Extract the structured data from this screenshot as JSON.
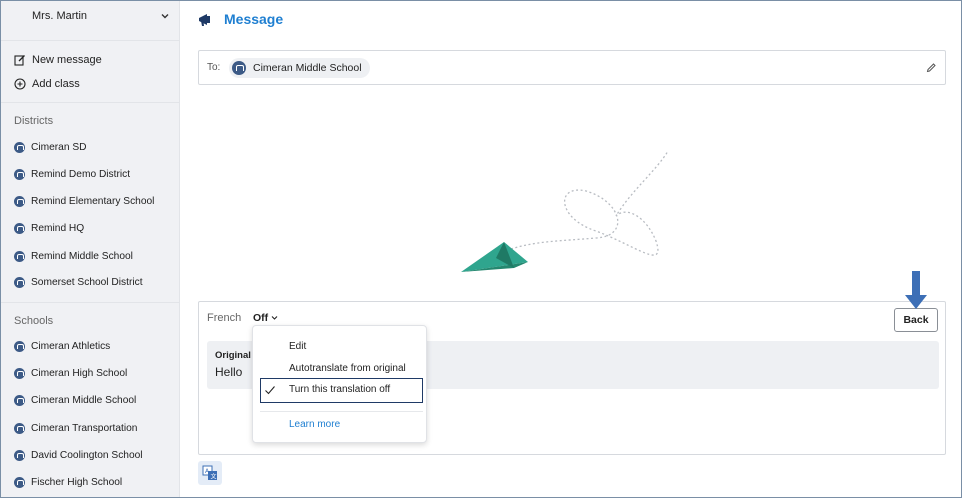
{
  "sidebar": {
    "user_name": "Mrs. Martin",
    "actions": [
      {
        "label": "New message",
        "icon": "compose-icon"
      },
      {
        "label": "Add class",
        "icon": "plus-circle-icon"
      }
    ],
    "districts_label": "Districts",
    "districts": [
      "Cimeran SD",
      "Remind Demo District",
      "Remind Elementary School",
      "Remind HQ",
      "Remind Middle School",
      "Somerset School District"
    ],
    "schools_label": "Schools",
    "schools": [
      "Cimeran Athletics",
      "Cimeran High School",
      "Cimeran Middle School",
      "Cimeran Transportation",
      "David Coolington School",
      "Fischer High School"
    ]
  },
  "header": {
    "title": "Message",
    "icon": "megaphone-icon"
  },
  "recipient": {
    "to_label": "To:",
    "chip_label": "Cimeran Middle School"
  },
  "composer": {
    "language_label": "French",
    "translation_state": "Off",
    "original_label": "Original",
    "original_text": "Hello",
    "back_label": "Back"
  },
  "dropdown": {
    "items": [
      "Edit",
      "Autotranslate from original",
      "Turn this translation off"
    ],
    "selected_index": 2,
    "learn_more": "Learn more"
  },
  "colors": {
    "accent": "#1f7fd1",
    "school_icon": "#3c5a86",
    "plane": "#2fa58e",
    "annotation_arrow": "#3d6fb6"
  }
}
